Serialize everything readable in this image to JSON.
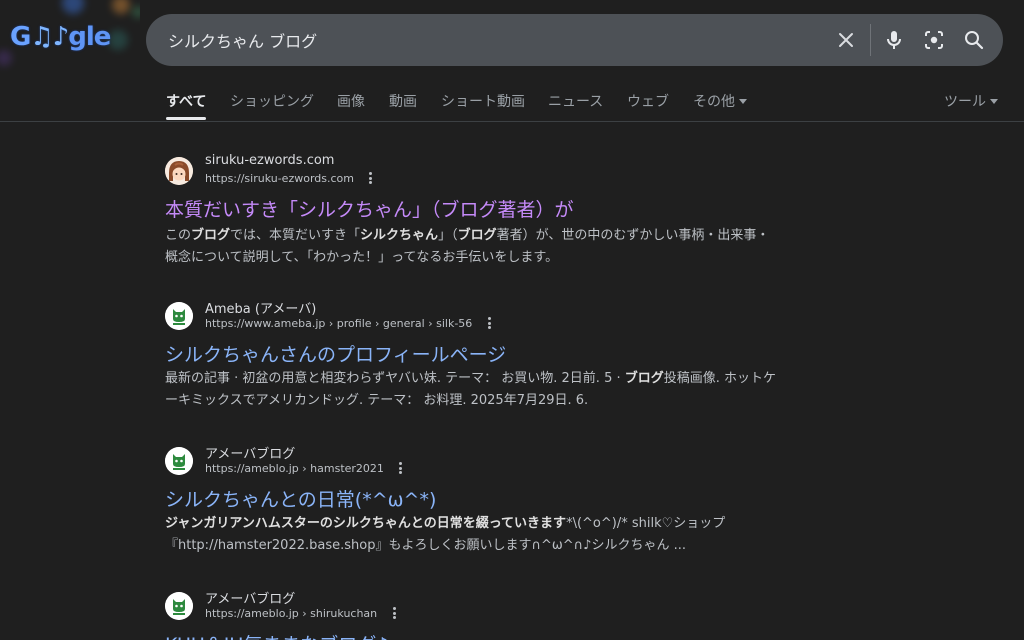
{
  "header": {
    "logo_text": "Google",
    "search": {
      "query": "シルクちゃん ブログ",
      "icons": [
        "clear-icon",
        "microphone-icon",
        "lens-camera-icon",
        "search-icon"
      ]
    }
  },
  "tabs": {
    "items": [
      {
        "label": "すべて"
      },
      {
        "label": "ショッピング"
      },
      {
        "label": "画像"
      },
      {
        "label": "動画"
      },
      {
        "label": "ショート動画"
      },
      {
        "label": "ニュース"
      },
      {
        "label": "ウェブ"
      },
      {
        "label": "その他"
      }
    ],
    "tools_label": "ツール"
  },
  "results": [
    {
      "site_name": "siruku-ezwords.com",
      "url": "https://siruku-ezwords.com",
      "title": "本質だいすき「シルクちゃん」（ブログ著者）が",
      "snippet_parts": [
        [
          "このブログでは、本質だいすき「シルクちゃん」（ブログ著者）が、世の中のむずかしい事柄・出来事・"
        ],
        [
          "概念について説明して、「わかった！」ってなるお手伝いをします。"
        ]
      ]
    },
    {
      "site_name": "Ameba (アメーバ)",
      "url": "https://www.ameba.jp › profile › general › silk-56",
      "title": "シルクちゃんさんのプロフィールページ",
      "snippet_line1": "最新の記事 · 初盆の用意と相変わらずヤバい妹. テーマ： お買い物. 2日前. 5 · ブログ投稿画像. ホットケ",
      "snippet_line2": "ーキミックスでアメリカンドッグ. テーマ： お料理. 2025年7月29日. 6."
    },
    {
      "site_name": "アメーバブログ",
      "url": "https://ameblo.jp › hamster2021",
      "title": "シルクちゃんとの日常(*^ω^*)",
      "snippet_line1_bold": "ジャンガリアンハムスターのシルクちゃんとの日常を綴っていきます",
      "snippet_line1_rest": "*\\(^o^)/* shilk♡ショップ",
      "snippet_line2": "『http://hamster2022.base.shop』もよろしくお願いします∩^ω^∩♪シルクちゃん ..."
    },
    {
      "site_name": "アメーバブログ",
      "url": "https://ameblo.jp › shirukuchan",
      "title": "KUU＆JU気ままなブログ♪"
    }
  ],
  "colors": {
    "background": "#1f1f1f",
    "visited_link": "#c58af9",
    "link": "#8ab4f8",
    "searchbox": "#4d5156"
  }
}
